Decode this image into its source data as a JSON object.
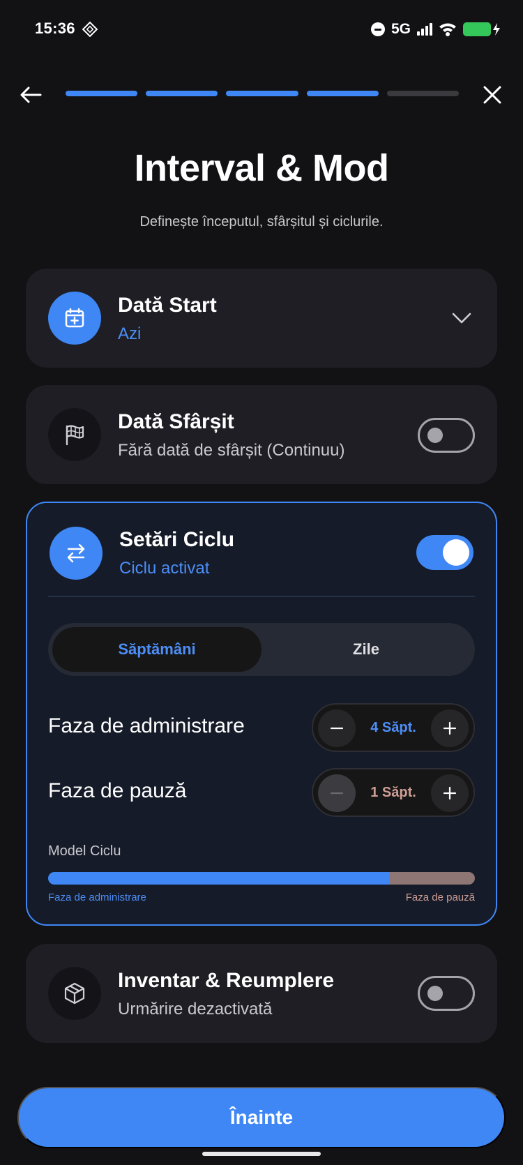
{
  "status_bar": {
    "time": "15:36",
    "network": "5G",
    "battery_color": "#34c759"
  },
  "navigation": {
    "back_icon": "arrow-left-icon",
    "close_icon": "close-icon",
    "progress_steps_total": 5,
    "progress_steps_completed": 4
  },
  "header": {
    "title": "Interval & Mod",
    "subtitle": "Definește începutul, sfârșitul și ciclurile."
  },
  "start_date": {
    "icon": "calendar-plus-icon",
    "title": "Dată Start",
    "value": "Azi",
    "chevron_icon": "chevron-down-icon"
  },
  "end_date": {
    "icon": "flag-icon",
    "title": "Dată Sfârșit",
    "value": "Fără dată de sfârșit (Continuu)",
    "toggle_on": false
  },
  "cycle": {
    "icon": "swap-arrows-icon",
    "title": "Setări Ciclu",
    "status": "Ciclu activat",
    "toggle_on": true,
    "unit_options": [
      "Săptămâni",
      "Zile"
    ],
    "selected_unit": "Săptămâni",
    "admin_phase": {
      "label": "Faza de administrare",
      "value": "4 Săpt.",
      "weeks": 4
    },
    "pause_phase": {
      "label": "Faza de pauză",
      "value": "1 Săpt.",
      "weeks": 1
    },
    "model": {
      "label": "Model Ciclu",
      "admin_legend": "Faza de administrare",
      "pause_legend": "Faza de pauză"
    }
  },
  "inventory": {
    "icon": "box-icon",
    "title": "Inventar & Reumplere",
    "status": "Urmărire dezactivată",
    "toggle_on": false
  },
  "actions": {
    "next_label": "Înainte"
  },
  "colors": {
    "accent": "#3f87f5",
    "background": "#121214",
    "card": "#1e1e24",
    "pause_phase": "#8d7674",
    "pause_text": "#cf9e96"
  }
}
